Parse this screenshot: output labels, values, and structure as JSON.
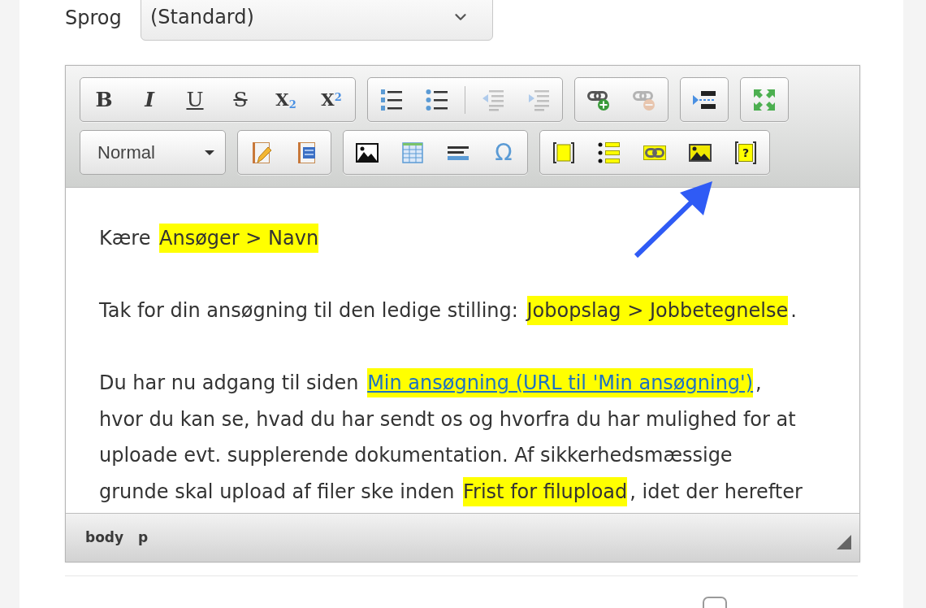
{
  "language": {
    "label": "Sprog",
    "value": "(Standard)"
  },
  "editor": {
    "toolbar": {
      "rows": [
        {
          "groups": [
            {
              "kind": "buttons",
              "buttons": [
                {
                  "kind": "bold",
                  "label": "B",
                  "disabled": false
                },
                {
                  "kind": "italic",
                  "label": "I",
                  "disabled": false
                },
                {
                  "kind": "underline",
                  "label": "U",
                  "disabled": false
                },
                {
                  "kind": "strike",
                  "label": "S",
                  "disabled": false
                },
                {
                  "kind": "subscript",
                  "label": "X$_{2}$",
                  "disabled": false
                },
                {
                  "kind": "superscript",
                  "label": "X$^{2}$",
                  "disabled": false
                }
              ]
            },
            {
              "kind": "buttons",
              "buttons": [
                {
                  "kind": "numbered-list",
                  "disabled": false
                },
                {
                  "kind": "bulleted-list",
                  "disabled": false
                },
                {
                  "kind": "separator"
                },
                {
                  "kind": "outdent",
                  "disabled": true
                },
                {
                  "kind": "indent",
                  "disabled": true
                }
              ]
            },
            {
              "kind": "buttons",
              "buttons": [
                {
                  "kind": "link",
                  "disabled": false
                },
                {
                  "kind": "unlink",
                  "disabled": true
                }
              ]
            },
            {
              "kind": "buttons",
              "buttons": [
                {
                  "kind": "page-break",
                  "disabled": false
                }
              ]
            },
            {
              "kind": "buttons",
              "buttons": [
                {
                  "kind": "maximize",
                  "disabled": false
                }
              ]
            }
          ]
        },
        {
          "groups": [
            {
              "kind": "dropdown",
              "value": "Normal"
            },
            {
              "kind": "buttons",
              "buttons": [
                {
                  "kind": "paste-text",
                  "disabled": false
                },
                {
                  "kind": "paste-word",
                  "disabled": false
                }
              ]
            },
            {
              "kind": "buttons",
              "buttons": [
                {
                  "kind": "image",
                  "disabled": false
                },
                {
                  "kind": "table",
                  "disabled": false
                },
                {
                  "kind": "horizontal-rule",
                  "disabled": false
                },
                {
                  "kind": "special-char",
                  "label": "Ω",
                  "disabled": false
                }
              ]
            },
            {
              "kind": "buttons",
              "buttons": [
                {
                  "kind": "field-box",
                  "disabled": false
                },
                {
                  "kind": "field-list",
                  "disabled": false
                },
                {
                  "kind": "field-link",
                  "disabled": false
                },
                {
                  "kind": "field-image",
                  "disabled": false
                },
                {
                  "kind": "field-question",
                  "label": "?",
                  "disabled": false
                }
              ]
            }
          ]
        }
      ]
    },
    "content": {
      "paragraphs": [
        {
          "segments": [
            {
              "kind": "text",
              "text": "Kære "
            },
            {
              "kind": "field",
              "text": "Ansøger > Navn"
            }
          ]
        },
        {
          "segments": [
            {
              "kind": "text",
              "text": "Tak for din ansøgning til den ledige stilling: "
            },
            {
              "kind": "field",
              "text": "Jobopslag > Jobbetegnelse"
            },
            {
              "kind": "text",
              "text": "."
            }
          ]
        },
        {
          "segments": [
            {
              "kind": "text",
              "text": "Du har nu adgang til siden "
            },
            {
              "kind": "link-field",
              "text": "Min ansøgning (URL til 'Min ansøgning')"
            },
            {
              "kind": "text",
              "text": ", hvor du kan se, hvad du har sendt os og hvorfra du har mulighed for at uploade evt. supplerende dokumentation. Af sikkerhedsmæssige grunde skal upload af filer ske inden "
            },
            {
              "kind": "field",
              "text": "Frist for filupload"
            },
            {
              "kind": "text",
              "text": ", idet der herefter"
            }
          ]
        }
      ]
    },
    "status_bar": {
      "path": [
        "body",
        "p"
      ]
    }
  },
  "footer": {
    "checkbox": {
      "checked": false
    }
  }
}
